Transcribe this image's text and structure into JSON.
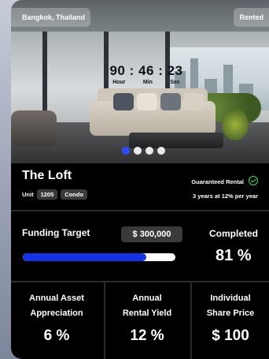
{
  "listing": {
    "location": "Bangkok, Thailand",
    "status": "Rented",
    "title": "The Loft",
    "unit_label": "Unit",
    "unit_number": "1205",
    "unit_type": "Condo",
    "guarantee_title": "Guaranteed Rental",
    "guarantee_terms": "3 years at 12% per year"
  },
  "countdown": {
    "hours": "90",
    "minutes": "46",
    "seconds": "23",
    "sep": ":",
    "hour_label": "Hour",
    "min_label": "Min",
    "sec_label": "Sec"
  },
  "carousel": {
    "slide_count": 4,
    "active_index": 0
  },
  "funding": {
    "target_label": "Funding Target",
    "target_amount": "$ 300,000",
    "completed_label": "Completed",
    "completed_value": "81 %",
    "progress_fraction": 0.81,
    "progress_color": "#1432e8"
  },
  "stats": [
    {
      "label_line1": "Annual Asset",
      "label_line2": "Appreciation",
      "value": "6 %"
    },
    {
      "label_line1": "Annual",
      "label_line2": "Rental Yield",
      "value": "12 %"
    },
    {
      "label_line1": "Individual",
      "label_line2": "Share Price",
      "value": "$ 100"
    }
  ],
  "colors": {
    "accent": "#2d4cff",
    "check": "#2ee06a",
    "card_bg": "#000000"
  }
}
